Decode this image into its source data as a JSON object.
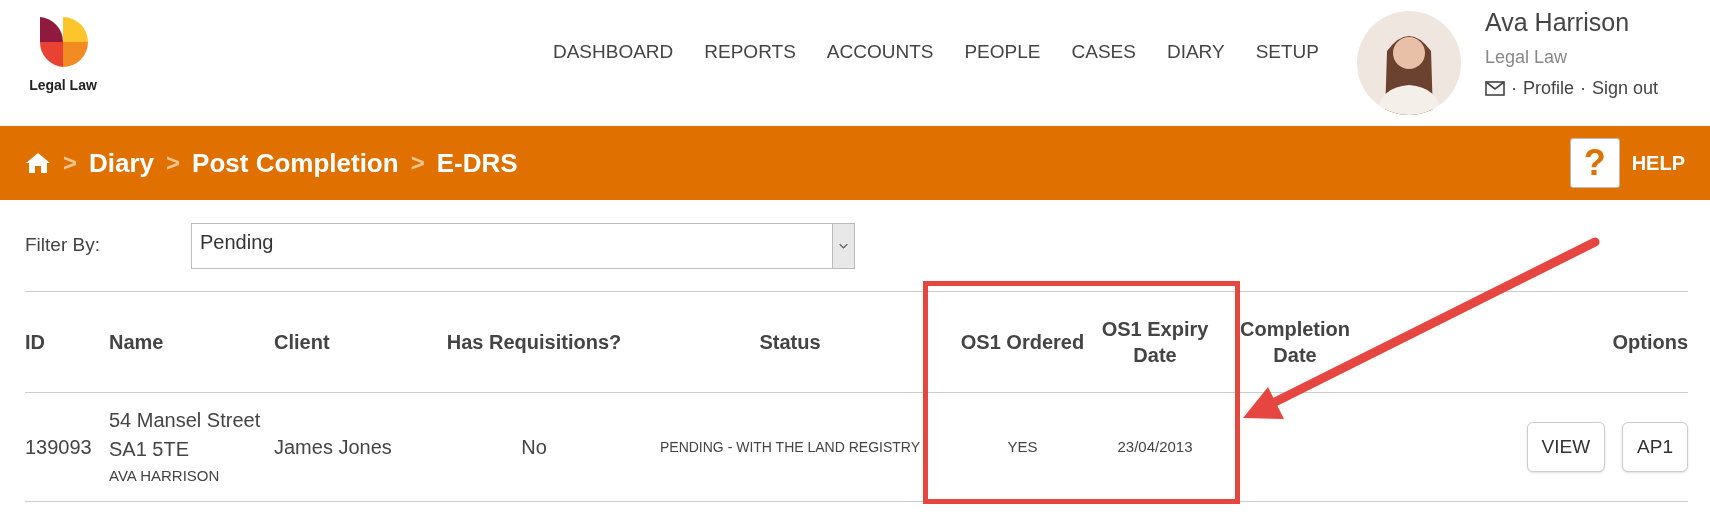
{
  "logo": {
    "text": "Legal Law"
  },
  "nav": [
    "DASHBOARD",
    "REPORTS",
    "ACCOUNTS",
    "PEOPLE",
    "CASES",
    "DIARY",
    "SETUP"
  ],
  "user": {
    "name": "Ava Harrison",
    "company": "Legal Law",
    "separator": "·",
    "links": [
      "Profile",
      "Sign out"
    ]
  },
  "breadcrumb_separator": ">",
  "breadcrumb": [
    "Diary",
    "Post Completion",
    "E-DRS"
  ],
  "help": {
    "icon": "?",
    "label": "HELP"
  },
  "filter": {
    "label": "Filter By:",
    "value": "Pending"
  },
  "table": {
    "columns": [
      {
        "label": "ID"
      },
      {
        "label": "Name"
      },
      {
        "label": "Client"
      },
      {
        "label": "Has Requisitions?"
      },
      {
        "label": "Status"
      },
      {
        "label": "OS1 Ordered"
      },
      {
        "label": "OS1 Expiry Date"
      },
      {
        "label": "Completion Date"
      },
      {
        "label": "Options"
      }
    ],
    "rows": [
      {
        "id": "139093",
        "name": [
          "54 Mansel Street",
          "SA1 5TE"
        ],
        "owner": "AVA HARRISON",
        "client": "James Jones",
        "has_requisitions": "No",
        "status": "PENDING - WITH THE LAND REGISTRY",
        "os1_ordered": "YES",
        "os1_expiry": "23/04/2013",
        "buttons": [
          "VIEW",
          "AP1"
        ]
      }
    ]
  }
}
